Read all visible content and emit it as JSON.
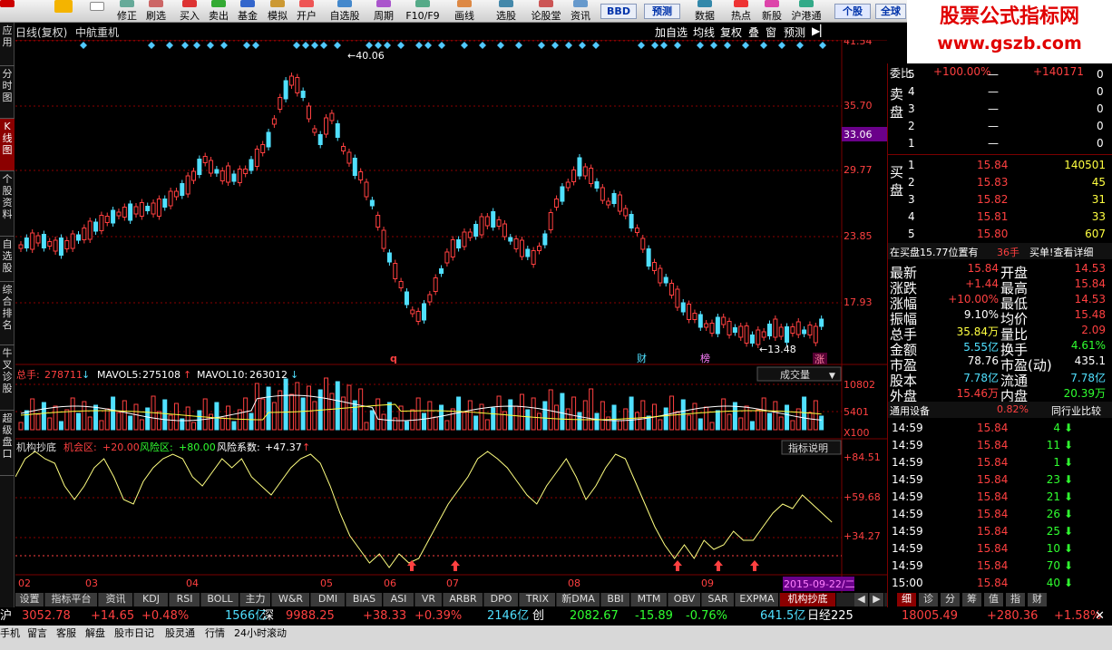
{
  "toolbar": {
    "items": [
      "修正",
      "刷选",
      "买入",
      "卖出",
      "基金",
      "模拟",
      "开户",
      "自选股",
      "周期",
      "F10/F9",
      "画线",
      "选股",
      "论股堂",
      "资讯",
      "数据",
      "热点",
      "新股",
      "沪港通"
    ],
    "bbd": "BBD",
    "forecast": "预测",
    "tab_individual": "个股",
    "tab_global": "全球"
  },
  "banner": {
    "line1": "股票公式指标网",
    "line2": "www.gszb.com"
  },
  "leftbar": {
    "tabs": [
      "应用",
      "分时图",
      "K线图",
      "个股资料",
      "自选股",
      "综合排名",
      "牛叉诊股",
      "超级盘口"
    ]
  },
  "chart": {
    "title": "日线(复权)",
    "stock_name": "中航重机",
    "buttons": [
      "加自选",
      "均线",
      "复权",
      "叠",
      "窗",
      "预测"
    ],
    "price_ticks": [
      "41.54",
      "35.70",
      "29.77",
      "23.85",
      "17.93"
    ],
    "current_price_tag": "33.06",
    "high_label": "40.06",
    "low_label": "13.48",
    "markers": [
      "q",
      "财",
      "榜",
      "涨"
    ],
    "marker_colors": [
      "#ff4040",
      "#50e0ff",
      "#ff80ff",
      "#ff4040"
    ]
  },
  "volume": {
    "label_total": "总手:",
    "value_total": "278711",
    "label_ma5": "MAVOL5:",
    "value_ma5": "275108",
    "label_ma10": "MAVOL10:",
    "value_ma10": "263012",
    "selector": "成交量",
    "ticks": [
      "10802",
      "5401"
    ],
    "unit": "X100"
  },
  "indicator": {
    "name": "机构抄底",
    "label_buy": "机会区:",
    "value_buy": "+20.00",
    "label_risk": "风险区:",
    "value_risk": "+80.00",
    "label_coef": "风险系数:",
    "value_coef": "+47.37",
    "help": "指标说明",
    "ticks": [
      "+84.51",
      "+59.68",
      "+34.27"
    ]
  },
  "xaxis": {
    "labels": [
      "02",
      "03",
      "04",
      "05",
      "06",
      "07",
      "08",
      "09"
    ],
    "date_tag": "2015-09-22/二"
  },
  "bottom_tabs": [
    "设置",
    "指标平台",
    "资讯",
    "KDJ",
    "RSI",
    "BOLL",
    "主力",
    "W&R",
    "DMI",
    "BIAS",
    "ASI",
    "VR",
    "ARBR",
    "DPO",
    "TRIX",
    "新DMA",
    "BBI",
    "MTM",
    "OBV",
    "SAR",
    "EXPMA",
    "机构抄底"
  ],
  "right_tabs": [
    "细",
    "诊",
    "分",
    "筹",
    "值",
    "指",
    "财"
  ],
  "order_book": {
    "ratio_label": "委比",
    "ratio_value": "+100.00%",
    "diff_value": "+140171",
    "sell_label": "卖盘",
    "buy_label": "买盘",
    "sells": [
      {
        "n": "5",
        "p": "—",
        "v": "0"
      },
      {
        "n": "4",
        "p": "—",
        "v": "0"
      },
      {
        "n": "3",
        "p": "—",
        "v": "0"
      },
      {
        "n": "2",
        "p": "—",
        "v": "0"
      },
      {
        "n": "1",
        "p": "—",
        "v": "0"
      }
    ],
    "buys": [
      {
        "n": "1",
        "p": "15.84",
        "v": "140501"
      },
      {
        "n": "2",
        "p": "15.83",
        "v": "45"
      },
      {
        "n": "3",
        "p": "15.82",
        "v": "31"
      },
      {
        "n": "4",
        "p": "15.81",
        "v": "33"
      },
      {
        "n": "5",
        "p": "15.80",
        "v": "607"
      }
    ],
    "buy_note": "在买盘15.77位置有",
    "buy_note_qty": "36手",
    "buy_note_link": "买单!查看详细"
  },
  "quote": {
    "rows": [
      {
        "l1": "最新",
        "v1": "15.84",
        "c1": "red",
        "l2": "开盘",
        "v2": "14.53",
        "c2": "red"
      },
      {
        "l1": "涨跌",
        "v1": "+1.44",
        "c1": "red",
        "l2": "最高",
        "v2": "15.84",
        "c2": "red"
      },
      {
        "l1": "涨幅",
        "v1": "+10.00%",
        "c1": "red",
        "l2": "最低",
        "v2": "14.53",
        "c2": "red"
      },
      {
        "l1": "振幅",
        "v1": "9.10%",
        "c1": "white",
        "l2": "均价",
        "v2": "15.48",
        "c2": "red"
      },
      {
        "l1": "总手",
        "v1": "35.84万",
        "c1": "yellow",
        "l2": "量比",
        "v2": "2.09",
        "c2": "red"
      },
      {
        "l1": "金额",
        "v1": "5.55亿",
        "c1": "cyan",
        "l2": "换手",
        "v2": "4.61%",
        "c2": "green"
      },
      {
        "l1": "市盈",
        "v1": "78.76",
        "c1": "white",
        "l2": "市盈(动)",
        "v2": "435.1",
        "c2": "white"
      },
      {
        "l1": "股本",
        "v1": "7.78亿",
        "c1": "cyan",
        "l2": "流通",
        "v2": "7.78亿",
        "c2": "cyan"
      },
      {
        "l1": "外盘",
        "v1": "15.46万",
        "c1": "red",
        "l2": "内盘",
        "v2": "20.39万",
        "c2": "green"
      }
    ]
  },
  "industry": {
    "name": "通用设备",
    "change": "0.82%",
    "compare": "同行业比较"
  },
  "ticks": [
    {
      "t": "14:59",
      "p": "15.84",
      "v": "4"
    },
    {
      "t": "14:59",
      "p": "15.84",
      "v": "11"
    },
    {
      "t": "14:59",
      "p": "15.84",
      "v": "1"
    },
    {
      "t": "14:59",
      "p": "15.84",
      "v": "23"
    },
    {
      "t": "14:59",
      "p": "15.84",
      "v": "21"
    },
    {
      "t": "14:59",
      "p": "15.84",
      "v": "26"
    },
    {
      "t": "14:59",
      "p": "15.84",
      "v": "25"
    },
    {
      "t": "14:59",
      "p": "15.84",
      "v": "10"
    },
    {
      "t": "14:59",
      "p": "15.84",
      "v": "70"
    },
    {
      "t": "15:00",
      "p": "15.84",
      "v": "40"
    }
  ],
  "statusbar": {
    "sh_label": "沪",
    "sh_index": "3052.78",
    "sh_change": "+14.65",
    "sh_pct": "+0.48%",
    "sh_amount": "1566亿",
    "sz_label": "深",
    "sz_index": "9988.25",
    "sz_change": "+38.33",
    "sz_pct": "+0.39%",
    "sz_amount": "2146亿",
    "cy_label": "创",
    "cy_index": "2082.67",
    "cy_change": "-15.89",
    "cy_pct": "-0.76%",
    "cy_amount": "641.5亿",
    "n225_label": "日经225",
    "n225_index": "18005.49",
    "n225_change": "+280.36",
    "n225_pct": "+1.58%"
  },
  "taskbar": [
    "手机",
    "留言",
    "客服",
    "解盘",
    "股市日记",
    "股灵通",
    "行情",
    "24小时滚动"
  ]
}
